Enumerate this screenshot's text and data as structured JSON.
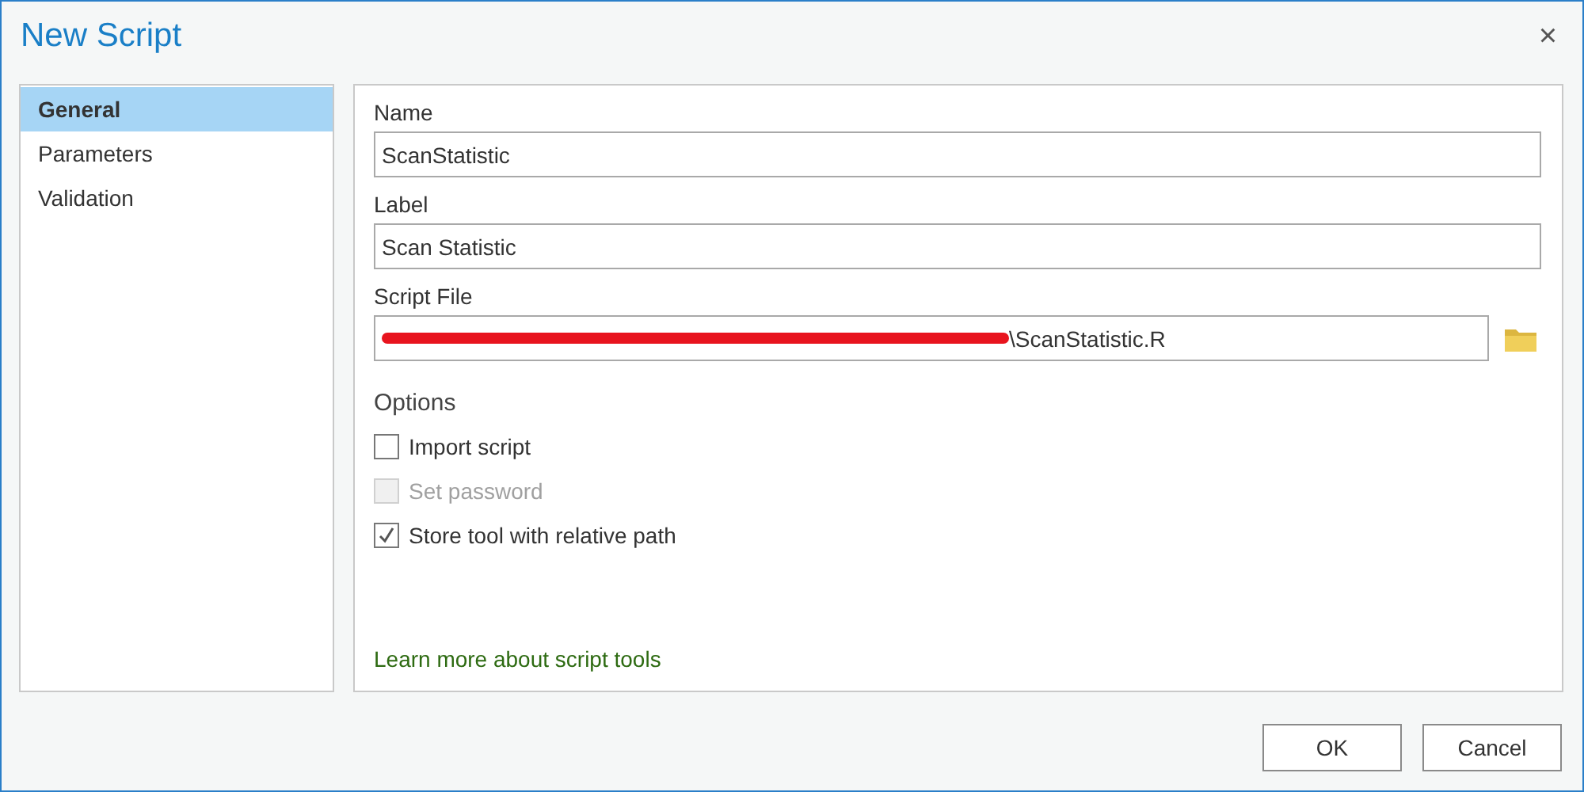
{
  "window": {
    "title": "New Script",
    "close": "×"
  },
  "sidebar": {
    "items": [
      {
        "label": "General",
        "selected": true
      },
      {
        "label": "Parameters",
        "selected": false
      },
      {
        "label": "Validation",
        "selected": false
      }
    ]
  },
  "fields": [
    {
      "label": "Name",
      "value": "ScanStatistic"
    },
    {
      "label": "Label",
      "value": "Scan Statistic"
    },
    {
      "label": "Script File",
      "value": "\\ScanStatistic.R",
      "redacted": true,
      "browse": true
    }
  ],
  "options": {
    "title": "Options",
    "items": [
      {
        "label": "Import script",
        "checked": false,
        "disabled": false
      },
      {
        "label": "Set password",
        "checked": false,
        "disabled": true
      },
      {
        "label": "Store tool with relative path",
        "checked": true,
        "disabled": false
      }
    ]
  },
  "link": "Learn more about script tools",
  "buttons": [
    "OK",
    "Cancel"
  ]
}
